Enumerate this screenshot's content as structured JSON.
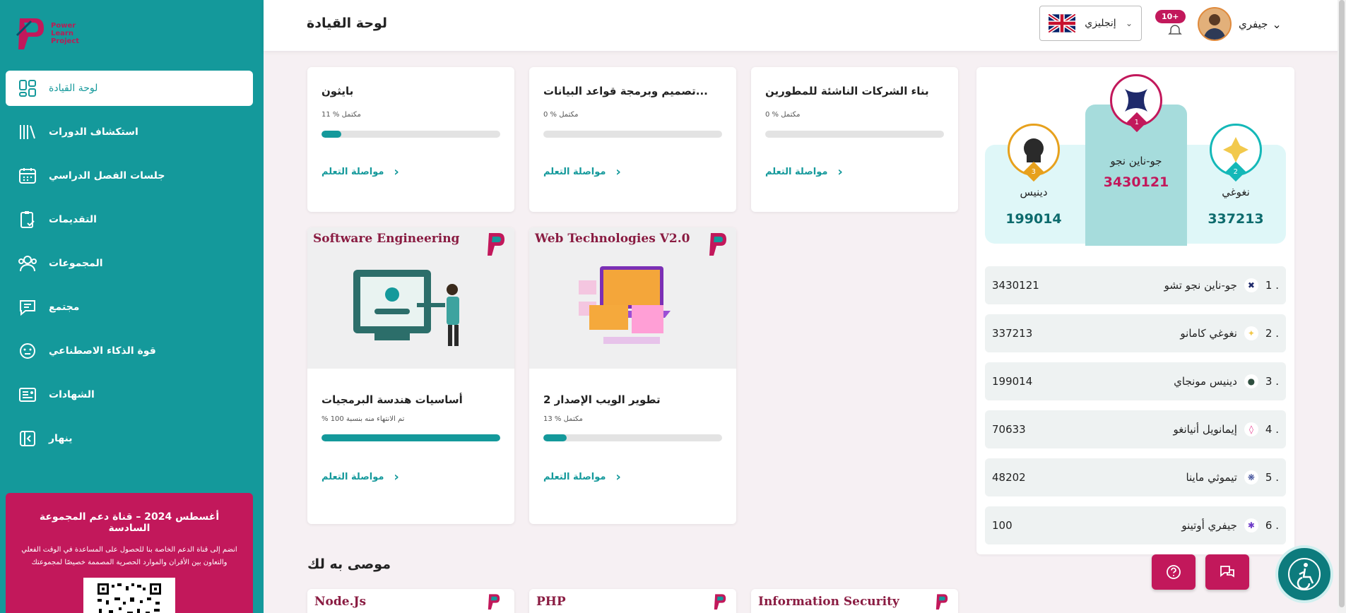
{
  "header": {
    "title": "لوحة القيادة",
    "language": "إنجليزي",
    "notifications": "10+",
    "user_name": "جيفري"
  },
  "logo": {
    "line1": "Power",
    "line2": "Learn",
    "line3": "Project"
  },
  "sidebar": {
    "items": [
      {
        "label": "لوحة القيادة",
        "icon": "dashboard-icon"
      },
      {
        "label": "استكشاف الدورات",
        "icon": "books-icon"
      },
      {
        "label": "جلسات الفصل الدراسي",
        "icon": "calendar-icon"
      },
      {
        "label": "التقديمات",
        "icon": "clipboard-check-icon"
      },
      {
        "label": "المجموعات",
        "icon": "users-icon"
      },
      {
        "label": "مجتمع",
        "icon": "chat-icon"
      },
      {
        "label": "قوة الذكاء الاصطناعي",
        "icon": "robot-icon"
      },
      {
        "label": "الشهادات",
        "icon": "certificate-icon"
      },
      {
        "label": "ينهار",
        "icon": "collapse-icon"
      }
    ],
    "promo": {
      "title": "أغسطس 2024 – قناة دعم المجموعة السادسة",
      "description": "انضم إلى قناة الدعم الخاصة بنا للحصول على المساعدة في الوقت الفعلي والتعاون بين الأقران والموارد الحصرية المصممة خصيصًا لمجموعتك"
    }
  },
  "courses": [
    {
      "title": "بايثون",
      "progress_text": "مكتمل % 11",
      "progress": 0.11,
      "continue": "مواصلة التعلم"
    },
    {
      "title": "تصميم وبرمجة قواعد البيانات...",
      "progress_text": "مكتمل % 0",
      "progress": 0,
      "continue": "مواصلة التعلم"
    },
    {
      "title": "بناء الشركات الناشئة للمطورين",
      "progress_text": "مكتمل % 0",
      "progress": 0,
      "continue": "مواصلة التعلم"
    },
    {
      "title": "أساسيات هندسة البرمجيات",
      "thumb_title": "Software Engineering",
      "progress_text": "% تم الانتهاء منه بنسبة 100",
      "progress": 1.0,
      "continue": "مواصلة التعلم"
    },
    {
      "title": "تطوير الويب الإصدار 2",
      "thumb_title": "Web Technologies V2.0",
      "progress_text": "مكتمل % 13",
      "progress": 0.13,
      "continue": "مواصلة التعلم"
    }
  ],
  "recommended": {
    "title": "موصى به لك",
    "items": [
      "Node.Js",
      "PHP",
      "Information Security"
    ]
  },
  "podium": {
    "first": {
      "name": "جو-ناين نجو",
      "score": "3430121",
      "rank": "1"
    },
    "second": {
      "name": "نغوغي",
      "score": "337213",
      "rank": "2"
    },
    "third": {
      "name": "دينيس",
      "score": "199014",
      "rank": "3"
    }
  },
  "leaderboard": [
    {
      "rank": "1 .",
      "name": "جو-ناين نجو تشو",
      "score": "3430121",
      "color": "#1f2a6b"
    },
    {
      "rank": "2 .",
      "name": "نغوغي كامانو",
      "score": "337213",
      "color": "#f2c94c"
    },
    {
      "rank": "3 .",
      "name": "دينيس مونجاي",
      "score": "199014",
      "color": "#2f4f3f"
    },
    {
      "rank": "4 .",
      "name": "إيمانويل أنيانغو",
      "score": "70633",
      "color": "#e84393"
    },
    {
      "rank": "5 .",
      "name": "تيموثي ماينا",
      "score": "48202",
      "color": "#2c3e8f"
    },
    {
      "rank": "6 .",
      "name": "جيفري أوتينو",
      "score": "100",
      "color": "#6c3ac7"
    }
  ],
  "colors": {
    "primary": "#14999b",
    "accent": "#c2185b"
  }
}
